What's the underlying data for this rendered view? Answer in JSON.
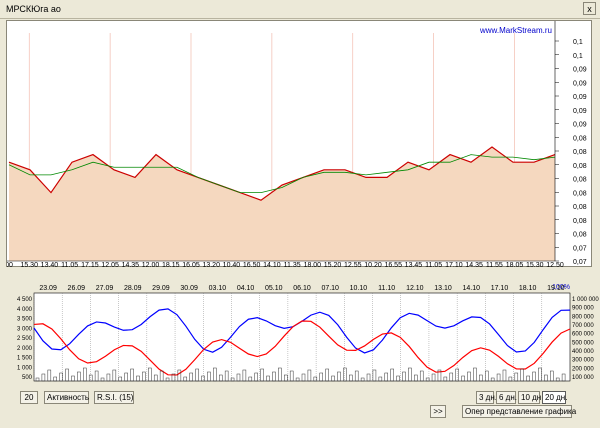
{
  "window": {
    "title": "МРСКЮга ао",
    "close_label": "x"
  },
  "chart": {
    "source_label": "www.MarkStream.ru",
    "price_ticks": [
      "0,1",
      "0,1",
      "0,09",
      "0,09",
      "0,09",
      "0,09",
      "0,09",
      "0,08",
      "0,08",
      "0,08",
      "0,08",
      "0,08",
      "0,08",
      "0,08",
      "0,08",
      "0,07",
      "0,07"
    ],
    "time_ticks": [
      "00",
      "15.30",
      "13.40",
      "11.05",
      "17.15",
      "12.05",
      "14.35",
      "12.00",
      "18.15",
      "16.05",
      "13.20",
      "10.40",
      "16.50",
      "14.10",
      "11.35",
      "18.00",
      "15.20",
      "12.55",
      "10.20",
      "16.55",
      "13.45",
      "11.05",
      "17.10",
      "14.35",
      "11.55",
      "18.05",
      "15.30",
      "12.50"
    ],
    "volume_label": "100%"
  },
  "lower": {
    "date_ticks": [
      "23.09",
      "26.09",
      "27.09",
      "28.09",
      "29.09",
      "30.09",
      "03.10",
      "04.10",
      "05.10",
      "06.10",
      "07.10",
      "10.10",
      "11.10",
      "12.10",
      "13.10",
      "14.10",
      "17.10",
      "18.10",
      "19.10"
    ],
    "left_ticks": [
      "4 500",
      "4 000",
      "3 500",
      "3 000",
      "2 500",
      "2 000",
      "1 500",
      "1 000",
      "500"
    ],
    "right_ticks": [
      "1 000 000",
      "900 000",
      "800 000",
      "700 000",
      "600 000",
      "500 000",
      "400 000",
      "300 000",
      "200 000",
      "100 000"
    ]
  },
  "chart_data": {
    "type": "line",
    "title": "",
    "xlabel": "",
    "ylabel": "",
    "ylim": [
      0.07,
      0.1
    ],
    "x": [
      "15.30",
      "13.40",
      "11.05",
      "17.15",
      "12.05",
      "14.35",
      "12.00",
      "18.15",
      "16.05",
      "13.20",
      "10.40",
      "16.50",
      "14.10",
      "11.35",
      "18.00",
      "15.20",
      "12.55",
      "10.20",
      "16.55",
      "13.45",
      "11.05",
      "17.10",
      "14.35",
      "11.55",
      "18.05",
      "15.30",
      "12.50"
    ],
    "series": [
      {
        "values": [
          0.083,
          0.082,
          0.079,
          0.083,
          0.084,
          0.082,
          0.081,
          0.084,
          0.082,
          0.081,
          0.08,
          0.079,
          0.078,
          0.08,
          0.081,
          0.082,
          0.082,
          0.081,
          0.081,
          0.083,
          0.082,
          0.084,
          0.083,
          0.085,
          0.083,
          0.083,
          0.084
        ]
      }
    ]
  },
  "controls": {
    "period": "20",
    "activity": "Активность",
    "rsi": "R.S.I. (15)",
    "scroll": ">>",
    "d3": "3 дн.",
    "d6": "6 дн.",
    "d10": "10 дн.",
    "d20": "20 дн.",
    "oper": "Опер представление графика"
  }
}
